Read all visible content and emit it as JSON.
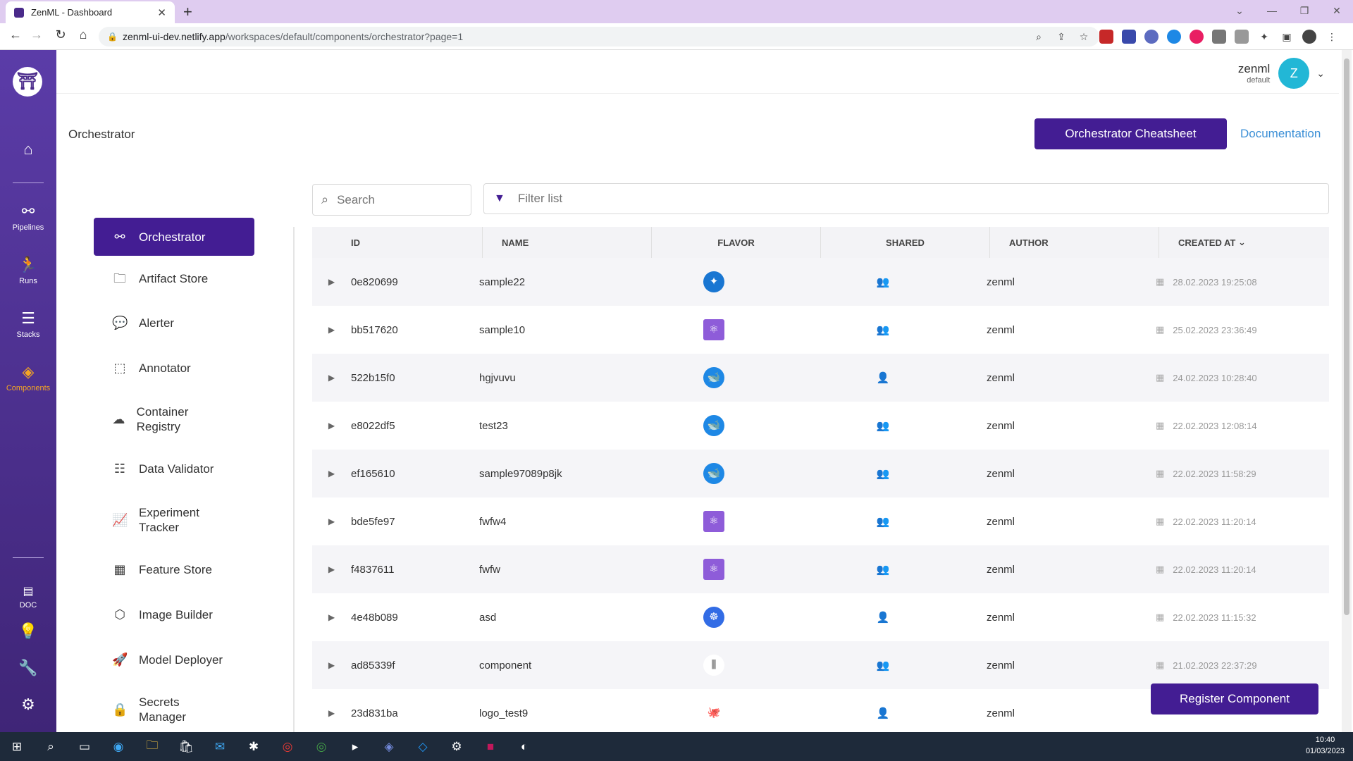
{
  "browser": {
    "tab_title": "ZenML - Dashboard",
    "url_host": "zenml-ui-dev.netlify.app",
    "url_path": "/workspaces/default/components/orchestrator?page=1"
  },
  "rail": {
    "items": [
      {
        "label": "Pipelines"
      },
      {
        "label": "Runs"
      },
      {
        "label": "Stacks"
      },
      {
        "label": "Components"
      }
    ],
    "doc_label": "DOC"
  },
  "header": {
    "username": "zenml",
    "workspace": "default",
    "avatar_letter": "Z"
  },
  "page": {
    "title": "Orchestrator",
    "cheatsheet_label": "Orchestrator Cheatsheet",
    "documentation_label": "Documentation",
    "register_label": "Register Component"
  },
  "subnav": [
    {
      "label": "Orchestrator",
      "icon": "orchestrator-icon"
    },
    {
      "label": "Artifact Store",
      "icon": "folder-icon"
    },
    {
      "label": "Alerter",
      "icon": "chat-icon"
    },
    {
      "label": "Annotator",
      "icon": "annotator-icon"
    },
    {
      "label": "Container Registry",
      "icon": "cloud-upload-icon"
    },
    {
      "label": "Data Validator",
      "icon": "validator-icon"
    },
    {
      "label": "Experiment Tracker",
      "icon": "chart-line-icon"
    },
    {
      "label": "Feature Store",
      "icon": "table-icon"
    },
    {
      "label": "Image Builder",
      "icon": "cube-icon"
    },
    {
      "label": "Model Deployer",
      "icon": "rocket-icon"
    },
    {
      "label": "Secrets Manager",
      "icon": "lock-icon"
    }
  ],
  "search": {
    "placeholder": "Search"
  },
  "filter": {
    "placeholder": "Filter list"
  },
  "table": {
    "headers": {
      "id": "ID",
      "name": "NAME",
      "flavor": "FLAVOR",
      "shared": "SHARED",
      "author": "AUTHOR",
      "created": "CREATED AT"
    },
    "rows": [
      {
        "id": "0e820699",
        "name": "sample22",
        "flavor": "airflow",
        "shared": true,
        "author": "zenml",
        "created": "28.02.2023 19:25:08"
      },
      {
        "id": "bb517620",
        "name": "sample10",
        "flavor": "purple",
        "shared": true,
        "author": "zenml",
        "created": "25.02.2023 23:36:49"
      },
      {
        "id": "522b15f0",
        "name": "hgjvuvu",
        "flavor": "docker",
        "shared": false,
        "author": "zenml",
        "created": "24.02.2023 10:28:40"
      },
      {
        "id": "e8022df5",
        "name": "test23",
        "flavor": "docker",
        "shared": true,
        "author": "zenml",
        "created": "22.02.2023 12:08:14"
      },
      {
        "id": "ef165610",
        "name": "sample97089p8jk",
        "flavor": "docker",
        "shared": true,
        "author": "zenml",
        "created": "22.02.2023 11:58:29"
      },
      {
        "id": "bde5fe97",
        "name": "fwfw4",
        "flavor": "purple",
        "shared": true,
        "author": "zenml",
        "created": "22.02.2023 11:20:14"
      },
      {
        "id": "f4837611",
        "name": "fwfw",
        "flavor": "purple",
        "shared": true,
        "author": "zenml",
        "created": "22.02.2023 11:20:14"
      },
      {
        "id": "4e48b089",
        "name": "asd",
        "flavor": "kubernetes",
        "shared": false,
        "author": "zenml",
        "created": "22.02.2023 11:15:32"
      },
      {
        "id": "ad85339f",
        "name": "component",
        "flavor": "kubeflow",
        "shared": true,
        "author": "zenml",
        "created": "21.02.2023 22:37:29"
      },
      {
        "id": "23d831ba",
        "name": "logo_test9",
        "flavor": "github",
        "shared": false,
        "author": "zenml",
        "created": ""
      }
    ]
  },
  "taskbar": {
    "time": "10:40",
    "date": "01/03/2023"
  },
  "colors": {
    "primary": "#431d93",
    "link": "#3b8fd6",
    "active_rail": "#f5a623"
  }
}
